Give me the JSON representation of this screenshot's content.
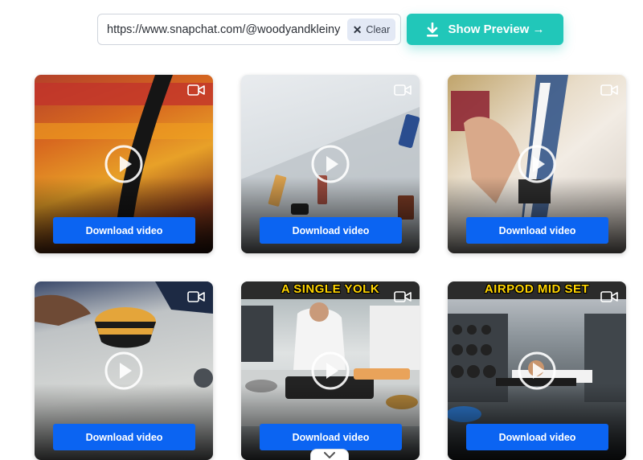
{
  "search": {
    "value": "https://www.snapchat.com/@woodyandkleiny",
    "clear_label": "Clear",
    "preview_label": "Show Preview →"
  },
  "videos": [
    {
      "caption": "",
      "download_label": "Download video"
    },
    {
      "caption": "",
      "download_label": "Download video"
    },
    {
      "caption": "",
      "download_label": "Download video"
    },
    {
      "caption": "",
      "download_label": "Download video"
    },
    {
      "caption": "A SINGLE YOLK",
      "download_label": "Download video"
    },
    {
      "caption": "AIRPOD MID SET",
      "download_label": "Download video"
    }
  ],
  "colors": {
    "accent": "#21c7b9",
    "download_button": "#0b64f2"
  },
  "icons": [
    "close-icon",
    "download-icon",
    "video-camera-icon",
    "play-icon",
    "chevron-down-icon"
  ]
}
